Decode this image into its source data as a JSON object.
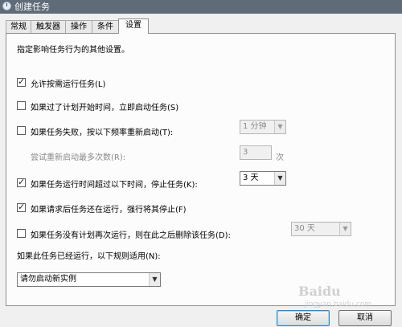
{
  "window": {
    "title": "创建任务"
  },
  "tabs": [
    {
      "label": "常规"
    },
    {
      "label": "触发器"
    },
    {
      "label": "操作"
    },
    {
      "label": "条件"
    },
    {
      "label": "设置"
    }
  ],
  "settings": {
    "description": "指定影响任务行为的其他设置。",
    "allow_on_demand": {
      "label": "允许按需运行任务(L)",
      "checked": true
    },
    "run_asap_missed": {
      "label": "如果过了计划开始时间，立即启动任务(S)",
      "checked": false
    },
    "restart_on_fail": {
      "label": "如果任务失败，按以下频率重新启动(T):",
      "checked": false,
      "interval": "1 分钟"
    },
    "restart_attempts": {
      "label": "尝试重新启动最多次数(R):",
      "value": "3",
      "unit": "次"
    },
    "stop_if_longer": {
      "label": "如果任务运行时间超过以下时间，停止任务(K):",
      "checked": true,
      "duration": "3 天"
    },
    "force_stop": {
      "label": "如果请求后任务还在运行，强行将其停止(F)",
      "checked": true
    },
    "delete_if_not_scheduled": {
      "label": "如果任务没有计划再次运行，则在此之后删除该任务(D):",
      "checked": false,
      "duration": "30 天"
    },
    "already_running": {
      "label": "如果此任务已经运行，以下规则适用(N):",
      "rule": "请勿启动新实例"
    }
  },
  "buttons": {
    "ok": "确定",
    "cancel": "取消"
  },
  "watermark": {
    "logo": "Baidu",
    "sub": "jingyan.baidu.com"
  }
}
